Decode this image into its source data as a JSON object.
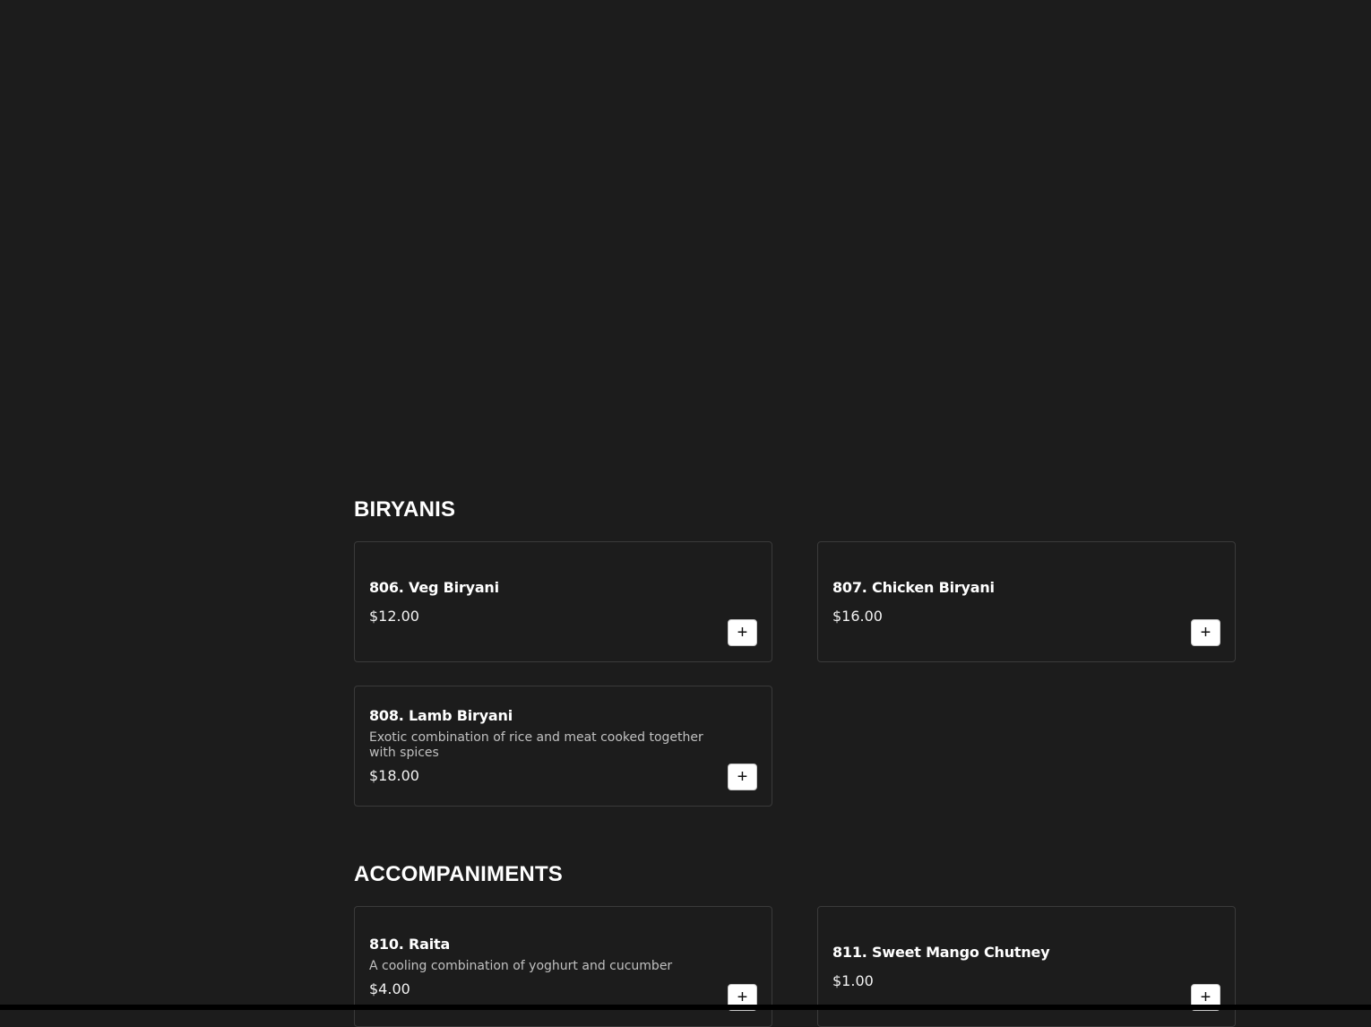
{
  "sections": [
    {
      "title": "BIRYANIS",
      "items": [
        {
          "name": "806. Veg Biryani",
          "price": "$12.00"
        },
        {
          "name": "807. Chicken Biryani",
          "price": "$16.00"
        },
        {
          "name": "808. Lamb Biryani",
          "description": "Exotic combination of rice and meat cooked together with spices",
          "price": "$18.00"
        }
      ]
    },
    {
      "title": "ACCOMPANIMENTS",
      "items": [
        {
          "name": "810. Raita",
          "description": "A cooling combination of yoghurt and cucumber",
          "price": "$4.00"
        },
        {
          "name": "811. Sweet Mango Chutney",
          "price": "$1.00"
        }
      ]
    }
  ],
  "icons": {
    "add": "+"
  }
}
